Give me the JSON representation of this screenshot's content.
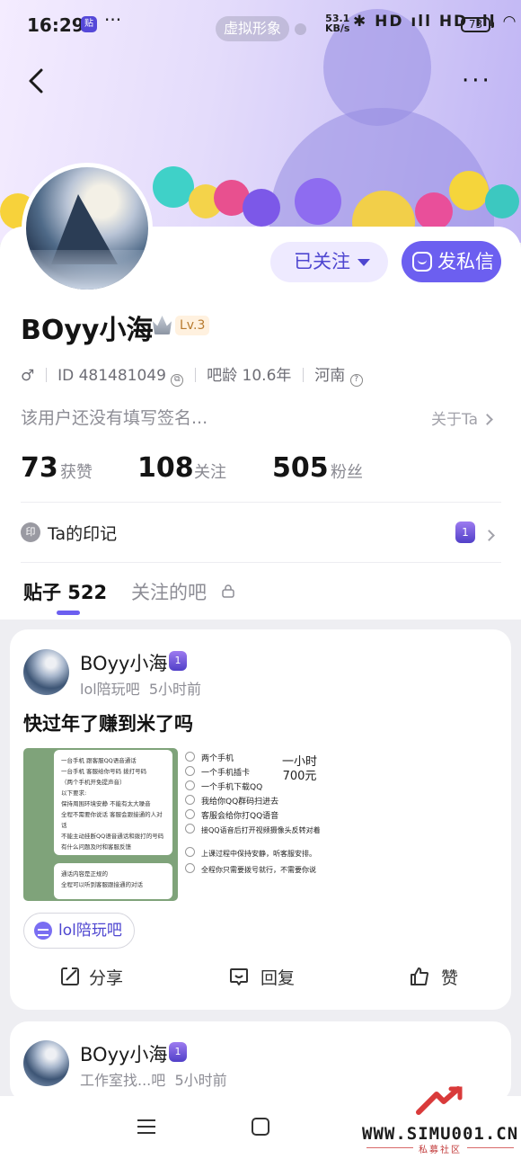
{
  "status_bar": {
    "time": "16:29",
    "app_badge": "贴",
    "more": "···",
    "virtual_label": "虚拟形象",
    "net_speed_top": "53.1",
    "net_speed_bottom": "KB/s",
    "signal_icons": "✱ HD ıll HD ıll ◠",
    "battery": "73"
  },
  "header": {
    "menu": "···"
  },
  "profile": {
    "name": "BOyy小海",
    "level": "Lv.3",
    "gender_icon": "♂",
    "id_label": "ID 481481049",
    "age_label": "吧龄 10.6年",
    "region": "河南",
    "signature": "该用户还没有填写签名...",
    "about_label": "关于Ta",
    "follow_button": "已关注",
    "message_button": "发私信",
    "stats": [
      {
        "value": "73",
        "label": "获赞"
      },
      {
        "value": "108",
        "label": "关注"
      },
      {
        "value": "505",
        "label": "粉丝"
      }
    ],
    "seal_icon_text": "印",
    "seal_label": "Ta的印记",
    "medal_text": "1"
  },
  "tabs": {
    "posts": "贴子 522",
    "followed_bars": "关注的吧"
  },
  "posts": [
    {
      "author": "BOyy小海",
      "bar": "lol陪玩吧",
      "time": "5小时前",
      "title": "快过年了赚到米了吗",
      "chip": "lol陪玩吧",
      "actions": {
        "share": "分享",
        "reply": "回复",
        "like": "赞"
      },
      "image_left_lines": [
        "一台手机 跟客服QQ语音通话",
        "一台手机 客服给你号码 拨打号码",
        "（两个手机开免提声音）",
        "以下要求:",
        "保持周围环境安静 不能有太大噪音",
        "全程不需要你说话 客服会跟接通的人对话",
        "不能主动挂断QQ语音通话和拨打的号码",
        "有什么问题及时和客服反馈",
        "通话内容是正规的",
        "全程可以听到客服跟接通的对话"
      ],
      "image_right_lines": [
        "两个手机",
        "一个手机插卡",
        "一个手机下载QQ",
        "我给你QQ群码扫进去",
        "客服会给你打QQ语音",
        "接QQ语音后打开视频摄像头反转对着",
        "上课过程中保持安静，听客服安排。",
        "全程你只需要拨号就行，不需要你说"
      ],
      "image_price_top": "一小时",
      "image_price_bottom": "700元"
    },
    {
      "author": "BOyy小海",
      "bar": "工作室找...吧",
      "time": "5小时前"
    }
  ],
  "watermark": {
    "text": "WWW.SIMU001.CN",
    "sub": "私募社区"
  }
}
